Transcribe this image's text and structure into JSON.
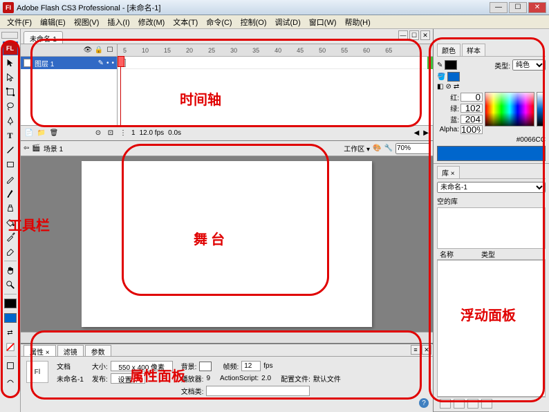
{
  "title": "Adobe Flash CS3 Professional - [未命名-1]",
  "menubar": [
    "文件(F)",
    "编辑(E)",
    "视图(V)",
    "插入(I)",
    "修改(M)",
    "文本(T)",
    "命令(C)",
    "控制(O)",
    "调试(D)",
    "窗口(W)",
    "帮助(H)"
  ],
  "doc_tab": "未命名-1",
  "timeline": {
    "layer_name": "图层 1",
    "ruler_marks": [
      "5",
      "10",
      "15",
      "20",
      "25",
      "30",
      "35",
      "40",
      "45",
      "50",
      "55",
      "60",
      "65"
    ],
    "frame": "1",
    "fps": "12.0 fps",
    "time": "0.0s"
  },
  "scene_bar": {
    "scene": "场景 1",
    "workarea": "工作区 ▾",
    "zoom": "70%"
  },
  "props": {
    "tabs": [
      "属性 ×",
      "滤镜",
      "参数"
    ],
    "doc_label": "文档",
    "doc_name": "未命名-1",
    "size_lbl": "大小:",
    "size_val": "550 x 400 像素",
    "publish_lbl": "发布:",
    "publish_btn": "设置...",
    "bg_lbl": "背景:",
    "fps_lbl": "帧频:",
    "fps_val": "12",
    "fps_unit": "fps",
    "player_lbl": "播放器:",
    "player_val": "9",
    "as_lbl": "ActionScript:",
    "as_val": "2.0",
    "profile_lbl": "配置文件:",
    "profile_val": "默认文件",
    "docclass_lbl": "文档类:"
  },
  "color_panel": {
    "tabs": [
      "颜色",
      "样本"
    ],
    "type_lbl": "类型:",
    "type_val": "纯色",
    "r_lbl": "红:",
    "r_val": "0",
    "g_lbl": "绿:",
    "g_val": "102",
    "b_lbl": "蓝:",
    "b_val": "204",
    "a_lbl": "Alpha:",
    "a_val": "100%",
    "hex": "#0066CC"
  },
  "lib_panel": {
    "tab": "库 ×",
    "doc": "未命名-1",
    "empty": "空的库",
    "col_name": "名称",
    "col_type": "类型"
  },
  "annotations": {
    "toolbar": "工具栏",
    "timeline": "时间轴",
    "stage": "舞 台",
    "props": "属性面板",
    "floating": "浮动面板"
  }
}
